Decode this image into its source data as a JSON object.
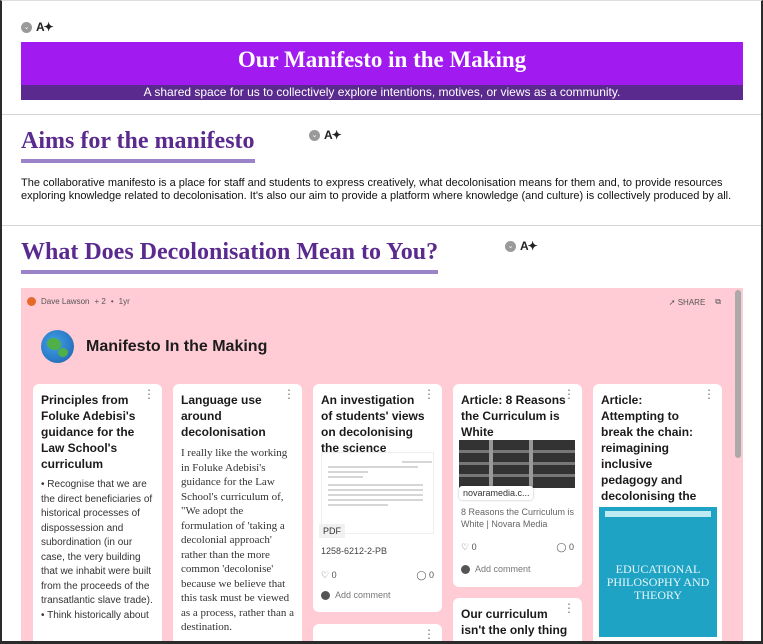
{
  "banner": {
    "title": "Our Manifesto in the Making",
    "subtitle": "A shared space for us to collectively explore intentions, motives, or views as a community."
  },
  "section_aims": {
    "heading": "Aims for the manifesto",
    "paragraph": "The collaborative manifesto is a place for staff and students to express creatively, what decolonisation means for them and, to provide resources exploring knowledge related to decolonisation. It's also our aim to provide a platform where knowledge (and culture) is collectively produced by all."
  },
  "section_decolonisation": {
    "heading": "What Does Decolonisation Mean to You?"
  },
  "controls": {
    "collapse_glyph": "⌄",
    "text_glyph": "A✦"
  },
  "board": {
    "author": "Dave Lawson",
    "contributors": "+ 2",
    "age": "1yr",
    "share_label": "SHARE",
    "title": "Manifesto In the Making",
    "cards": [
      {
        "title": "Principles from Foluke Adebisi's guidance for the Law School's curriculum",
        "body": "• Recognise that we are the direct beneficiaries of historical processes of dispossession and subordination (in our case, the very building that we inhabit were built from the proceeds of the transatlantic slave trade).",
        "body_more": "• Think historically about"
      },
      {
        "title": "Language use around decolonisation",
        "body": "I really like the working in Foluke Adebisi's guidance for the Law School's curriculum of, \"We adopt the formulation of 'taking a decolonial approach' rather than the more common 'decolonise' because we believe that this task must be viewed as a process, rather than a destination."
      },
      {
        "title": "An investigation of students' views on decolonising the science curriculum",
        "pdf_label": "PDF",
        "doc_id": "1258-6212-2-PB",
        "likes": "0",
        "comments": "0",
        "add_comment": "Add comment"
      },
      {
        "title": "Article: 8 Reasons the Curriculum is White",
        "link_host": "novaramedia.c...",
        "link_desc": "8 Reasons the Curriculum is White | Novara Media",
        "likes": "0",
        "comments": "0",
        "add_comment": "Add comment"
      },
      {
        "title": "Article: Attempting to break the chain: reimagining inclusive pedagogy and decolonising the curriculum within the academy",
        "book_text": "EDUCATIONAL PHILOSOPHY AND THEORY"
      },
      {
        "title": "Our curriculum isn't the only thing"
      }
    ]
  }
}
